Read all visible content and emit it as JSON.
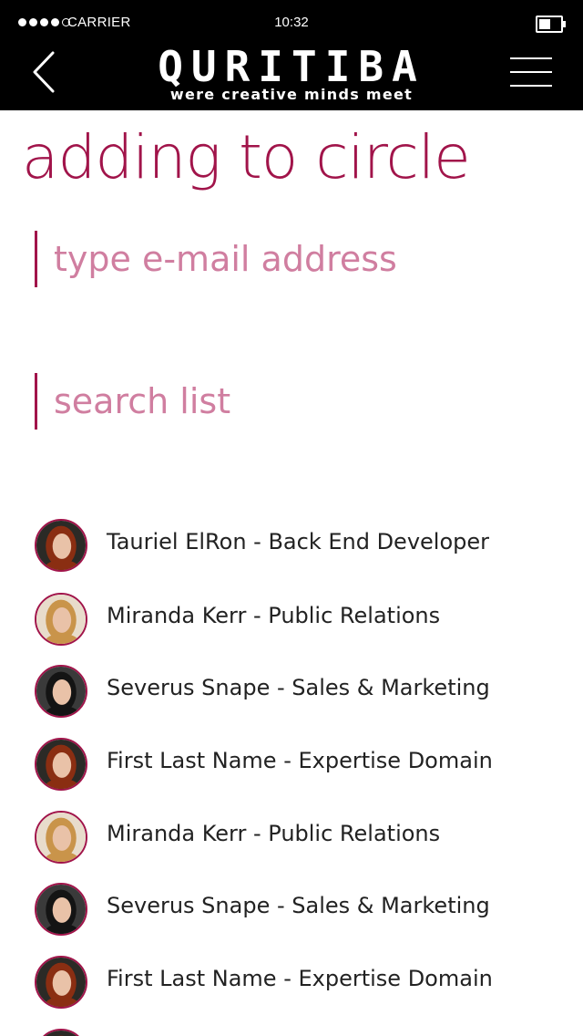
{
  "status_bar": {
    "carrier": "CARRIER",
    "time": "10:32",
    "battery_level": 0.55
  },
  "header": {
    "brand_name": "QURITIBA",
    "tagline": "were creative minds meet",
    "back_icon": "chevron-left-icon",
    "menu_icon": "hamburger-menu-icon"
  },
  "page": {
    "title": "adding to circle"
  },
  "email_input": {
    "value": "",
    "placeholder": "type e-mail address"
  },
  "search_input": {
    "value": "",
    "placeholder": "search list"
  },
  "colors": {
    "accent": "#a1144a",
    "placeholder": "#d07ea0",
    "header_bg": "#000000"
  },
  "contacts": [
    {
      "label": "Tauriel ElRon - Back End Developer",
      "avatar": "red-hair"
    },
    {
      "label": "Miranda Kerr - Public Relations",
      "avatar": "blonde"
    },
    {
      "label": "Severus Snape - Sales & Marketing",
      "avatar": "dark-hair"
    },
    {
      "label": "First Last Name - Expertise Domain",
      "avatar": "red-hair"
    },
    {
      "label": "Miranda Kerr - Public Relations",
      "avatar": "blonde"
    },
    {
      "label": "Severus Snape - Sales & Marketing",
      "avatar": "dark-hair"
    },
    {
      "label": "First Last Name - Expertise Domain",
      "avatar": "red-hair"
    },
    {
      "label": "",
      "avatar": "red-hair"
    }
  ]
}
